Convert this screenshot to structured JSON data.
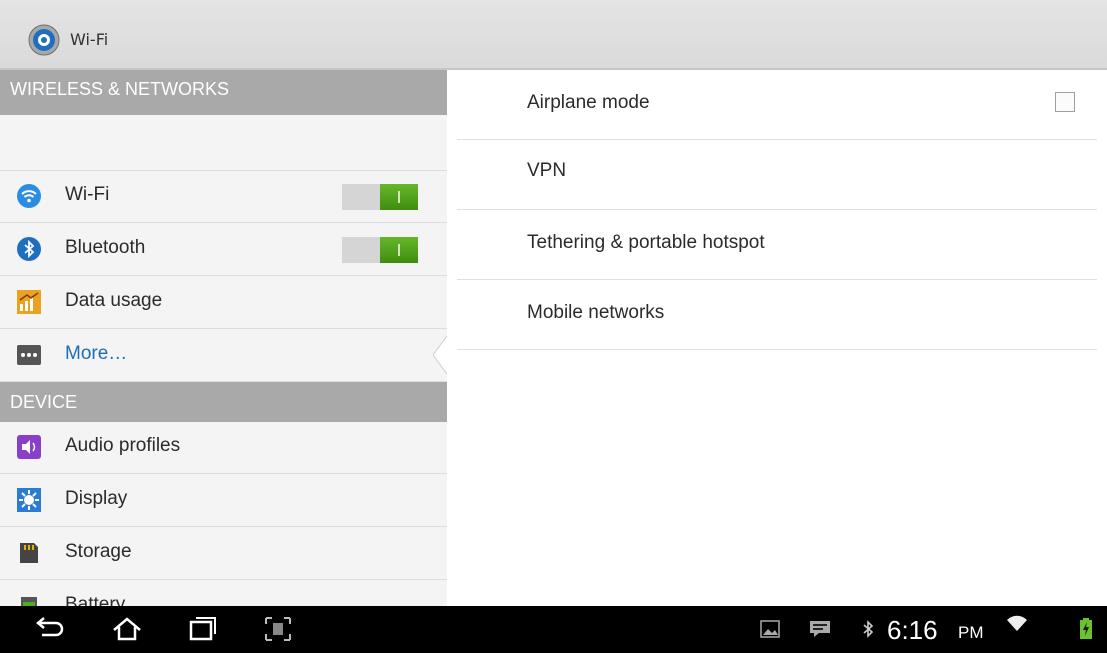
{
  "action_bar": {
    "title": "Wi-Fi",
    "icon": "settings-gear-icon"
  },
  "left_pane": {
    "sections": [
      {
        "header": "WIRELESS & NETWORKS"
      },
      {
        "header": "DEVICE"
      }
    ],
    "items": [
      {
        "label": "Wi-Fi",
        "icon": "wifi-icon",
        "toggle": "on"
      },
      {
        "label": "Bluetooth",
        "icon": "bluetooth-icon",
        "toggle": "on"
      },
      {
        "label": "Data usage",
        "icon": "data-usage-icon"
      },
      {
        "label": "More…",
        "icon": "more-icon",
        "selected": true
      },
      {
        "label": "Audio profiles",
        "icon": "audio-profiles-icon"
      },
      {
        "label": "Display",
        "icon": "display-icon"
      },
      {
        "label": "Storage",
        "icon": "storage-icon"
      },
      {
        "label": "Battery",
        "icon": "battery-icon"
      }
    ]
  },
  "right_pane": {
    "items": [
      {
        "label": "Airplane mode",
        "checked": false
      },
      {
        "label": "VPN"
      },
      {
        "label": "Tethering & portable hotspot"
      },
      {
        "label": "Mobile networks"
      }
    ]
  },
  "nav_bar": {
    "buttons": [
      "back-icon",
      "home-icon",
      "recent-apps-icon",
      "screenshot-icon"
    ],
    "status": {
      "time": "6:16",
      "ampm": "PM"
    }
  },
  "colors": {
    "section_header": "#a9a9a9",
    "selected_text": "#1a6fb5",
    "toggle_on": "#4e9f18"
  }
}
